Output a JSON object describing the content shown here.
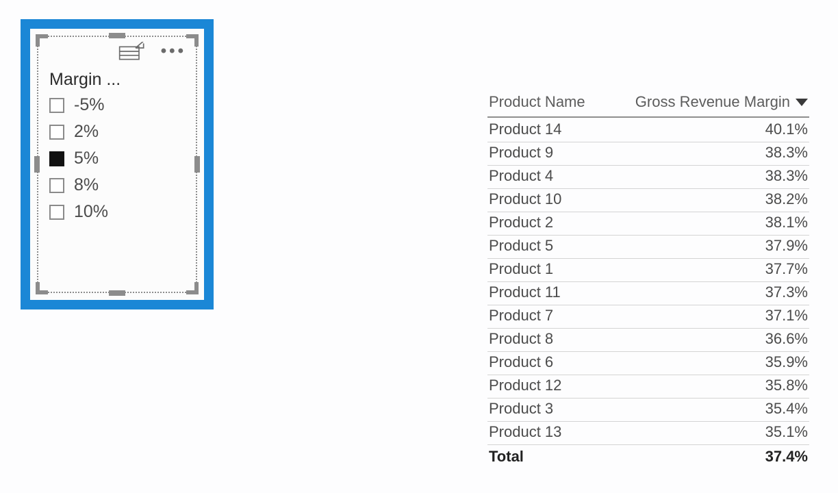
{
  "slicer": {
    "title": "Margin ...",
    "items": [
      {
        "label": "-5%",
        "checked": false
      },
      {
        "label": "2%",
        "checked": false
      },
      {
        "label": "5%",
        "checked": true
      },
      {
        "label": "8%",
        "checked": false
      },
      {
        "label": "10%",
        "checked": false
      }
    ]
  },
  "table": {
    "header_name": "Product Name",
    "header_value": "Gross Revenue Margin",
    "sort_direction": "desc",
    "rows": [
      {
        "name": "Product 14",
        "value": "40.1%"
      },
      {
        "name": "Product 9",
        "value": "38.3%"
      },
      {
        "name": "Product 4",
        "value": "38.3%"
      },
      {
        "name": "Product 10",
        "value": "38.2%"
      },
      {
        "name": "Product 2",
        "value": "38.1%"
      },
      {
        "name": "Product 5",
        "value": "37.9%"
      },
      {
        "name": "Product 1",
        "value": "37.7%"
      },
      {
        "name": "Product 11",
        "value": "37.3%"
      },
      {
        "name": "Product 7",
        "value": "37.1%"
      },
      {
        "name": "Product 8",
        "value": "36.6%"
      },
      {
        "name": "Product 6",
        "value": "35.9%"
      },
      {
        "name": "Product 12",
        "value": "35.8%"
      },
      {
        "name": "Product 3",
        "value": "35.4%"
      },
      {
        "name": "Product 13",
        "value": "35.1%"
      }
    ],
    "total_label": "Total",
    "total_value": "37.4%"
  }
}
